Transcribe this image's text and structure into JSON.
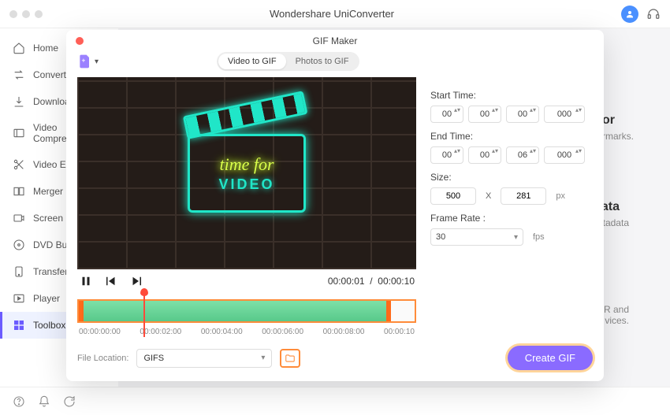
{
  "app": {
    "title": "Wondershare UniConverter"
  },
  "sidebar": {
    "items": [
      {
        "label": "Home",
        "icon": "home-icon"
      },
      {
        "label": "Converter",
        "icon": "converter-icon"
      },
      {
        "label": "Downloader",
        "icon": "download-icon"
      },
      {
        "label": "Video Compressor",
        "icon": "compress-icon"
      },
      {
        "label": "Video Editor",
        "icon": "scissors-icon"
      },
      {
        "label": "Merger",
        "icon": "merger-icon"
      },
      {
        "label": "Screen Recorder",
        "icon": "record-icon"
      },
      {
        "label": "DVD Burner",
        "icon": "dvd-icon"
      },
      {
        "label": "Transfer",
        "icon": "transfer-icon"
      },
      {
        "label": "Player",
        "icon": "player-icon"
      },
      {
        "label": "Toolbox",
        "icon": "toolbox-icon"
      }
    ],
    "active_index": 10
  },
  "background_hints": {
    "or": "or",
    "rmarks": "rmarks.",
    "ata": "ata",
    "tadata": "tadata",
    "rand": "R and",
    "vices": "vices."
  },
  "modal": {
    "title": "GIF Maker",
    "tabs": {
      "video": "Video to GIF",
      "photos": "Photos to GIF",
      "active": "video"
    },
    "preview": {
      "line1": "time for",
      "line2": "VIDEO"
    },
    "time": {
      "current": "00:00:01",
      "sep": "/",
      "total": "00:00:10"
    },
    "ruler": [
      "00:00:00:00",
      "00:00:02:00",
      "00:00:04:00",
      "00:00:06:00",
      "00:00:08:00",
      "00:00:10"
    ],
    "settings": {
      "start_label": "Start Time:",
      "start": {
        "hh": "00",
        "mm": "00",
        "ss": "00",
        "ms": "000"
      },
      "end_label": "End Time:",
      "end": {
        "hh": "00",
        "mm": "00",
        "ss": "06",
        "ms": "000"
      },
      "size_label": "Size:",
      "size": {
        "w": "500",
        "h": "281",
        "unit": "px"
      },
      "rate_label": "Frame Rate :",
      "rate": {
        "value": "30",
        "unit": "fps"
      }
    },
    "footer": {
      "loc_label": "File Location:",
      "loc_value": "GIFS",
      "create_label": "Create GIF"
    }
  }
}
